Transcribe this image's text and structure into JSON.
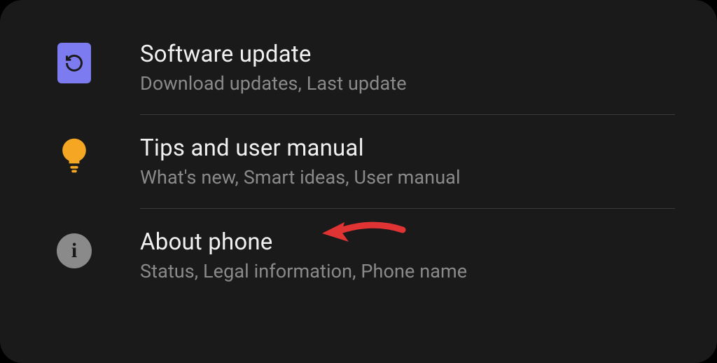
{
  "settings": {
    "items": [
      {
        "title": "Software update",
        "subtitle": "Download updates, Last update",
        "icon": "refresh-icon"
      },
      {
        "title": "Tips and user manual",
        "subtitle": "What's new, Smart ideas, User manual",
        "icon": "lightbulb-icon"
      },
      {
        "title": "About phone",
        "subtitle": "Status, Legal information, Phone name",
        "icon": "info-icon"
      }
    ]
  },
  "colors": {
    "software_icon_bg": "#7c7cf0",
    "bulb_icon": "#f5a623",
    "info_icon_bg": "#8a8a8a",
    "annotation_arrow": "#e03434"
  },
  "annotation": {
    "type": "arrow",
    "points_to": "About phone"
  }
}
